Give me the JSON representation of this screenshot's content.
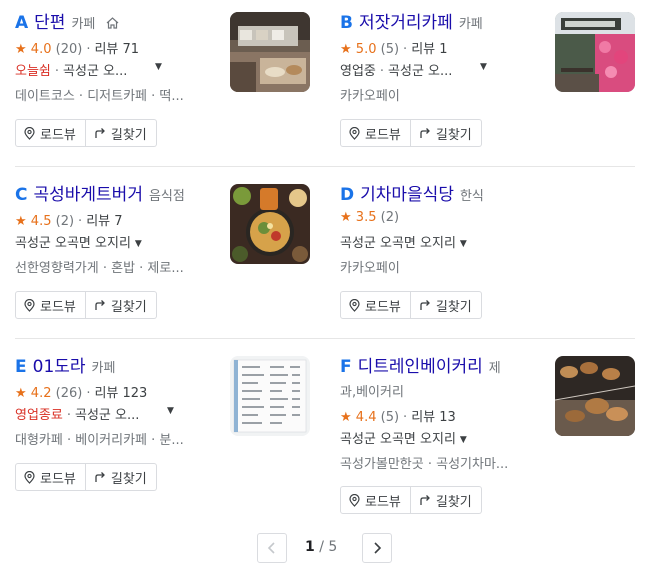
{
  "places": [
    {
      "letter": "A",
      "name": "단편",
      "category": "카페",
      "home_icon": "home-icon",
      "rating": "4.0",
      "review_count": "(20)",
      "reviews": "리뷰 71",
      "status": "오늘쉼",
      "address": "곡성군 오...",
      "description": "데이트코스 · 디저트카페 · 떡...",
      "thumb_icon": "cafe-interior-photo"
    },
    {
      "letter": "B",
      "name": "저잣거리카페",
      "category": "카페",
      "rating": "5.0",
      "review_count": "(5)",
      "reviews": "리뷰 1",
      "status": "영업중",
      "address": "곡성군 오...",
      "description": "카카오페이",
      "thumb_icon": "storefront-photo"
    },
    {
      "letter": "C",
      "name": "곡성바게트버거",
      "category": "음식점",
      "rating": "4.5",
      "review_count": "(2)",
      "reviews": "리뷰 7",
      "address": "곡성군 오곡면 오지리",
      "description": "선한영향력가게 · 혼밥 · 제로...",
      "thumb_icon": "korean-food-photo"
    },
    {
      "letter": "D",
      "name": "기차마을식당",
      "category": "한식",
      "rating": "3.5",
      "review_count": "(2)",
      "address": "곡성군 오곡면 오지리",
      "description": "카카오페이"
    },
    {
      "letter": "E",
      "name": "01도라",
      "category": "카페",
      "rating": "4.2",
      "review_count": "(26)",
      "reviews": "리뷰 123",
      "status": "영업종료",
      "address": "곡성군 오...",
      "description": "대형카페 · 베이커리카페 · 분...",
      "thumb_icon": "menu-board-photo"
    },
    {
      "letter": "F",
      "name": "디트레인베이커리",
      "category_line1": "제",
      "category_line2": "과,베이커리",
      "rating": "4.4",
      "review_count": "(5)",
      "reviews": "리뷰 13",
      "address": "곡성군 오곡면 오지리",
      "description": "곡성가볼만한곳 · 곡성기차마...",
      "thumb_icon": "bakery-bread-photo"
    }
  ],
  "buttons": {
    "roadview": "로드뷰",
    "directions": "길찾기"
  },
  "pagination": {
    "current": "1",
    "separator": "/",
    "total": "5"
  },
  "colors": {
    "letter": "#1a73e8",
    "name": "#1a0dab",
    "star": "#e7711b",
    "closed": "#d93025"
  }
}
